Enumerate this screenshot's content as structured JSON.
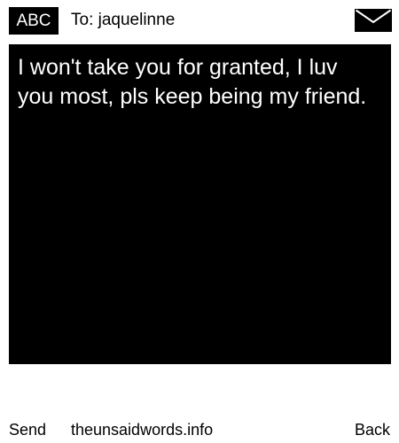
{
  "header": {
    "input_mode": "ABC",
    "recipient": "To: jaquelinne",
    "icon": "envelope-icon"
  },
  "message": {
    "body": "I won't take you for granted, I luv you most, pls keep being my friend."
  },
  "footer": {
    "send_label": "Send",
    "site": "theunsaidwords.info",
    "back_label": "Back"
  },
  "colors": {
    "background": "#ffffff",
    "message_box": "#000000",
    "message_text": "#ffffff"
  }
}
